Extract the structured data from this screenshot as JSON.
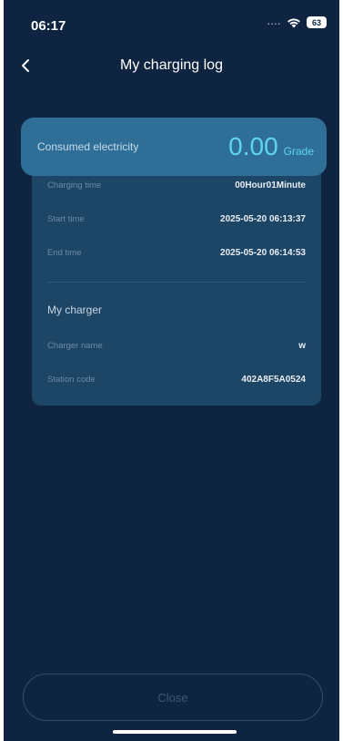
{
  "status_bar": {
    "time": "06:17",
    "signal": "....",
    "battery": "63"
  },
  "nav": {
    "title": "My charging log"
  },
  "summary": {
    "label": "Consumed electricity",
    "value": "0.00",
    "unit": "Grade"
  },
  "details": {
    "charging_time": {
      "label": "Charging time",
      "value": "00Hour01Minute"
    },
    "start_time": {
      "label": "Start time",
      "value": "2025-05-20 06:13:37"
    },
    "end_time": {
      "label": "End time",
      "value": "2025-05-20 06:14:53"
    }
  },
  "charger": {
    "section_title": "My charger",
    "name": {
      "label": "Charger name",
      "value": "w"
    },
    "station_code": {
      "label": "Station code",
      "value": "402A8F5A0524"
    }
  },
  "footer": {
    "close_label": "Close"
  },
  "colors": {
    "background": "#0f2440",
    "summary_card": "#2f6f97",
    "details_card": "#1d4565",
    "accent": "#5fd4f0"
  }
}
